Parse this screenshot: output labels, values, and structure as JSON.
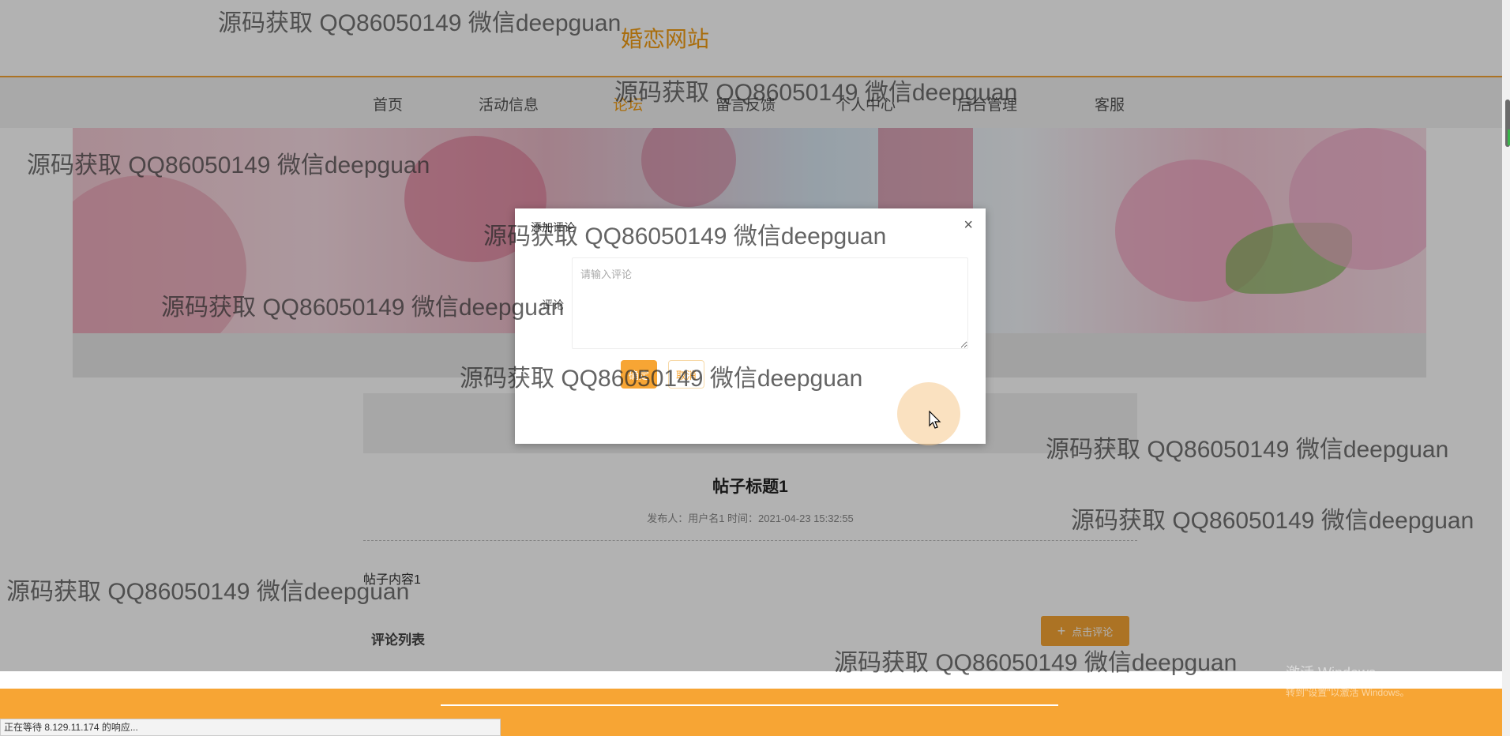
{
  "site": {
    "title": "婚恋网站"
  },
  "nav": {
    "items": [
      {
        "label": "首页",
        "active": false
      },
      {
        "label": "活动信息",
        "active": false
      },
      {
        "label": "论坛",
        "active": true
      },
      {
        "label": "留言反馈",
        "active": false
      },
      {
        "label": "个人中心",
        "active": false
      },
      {
        "label": "后台管理",
        "active": false
      },
      {
        "label": "客服",
        "active": false
      }
    ]
  },
  "post": {
    "title": "帖子标题1",
    "meta": "发布人：用户名1 时间：2021-04-23 15:32:55",
    "content": "帖子内容1"
  },
  "comments": {
    "heading": "评论列表",
    "add_button_label": "点击评论"
  },
  "modal": {
    "title": "添加评论",
    "close_glyph": "×",
    "field_label": "评论",
    "placeholder": "请输入评论",
    "confirm_label": "确定",
    "cancel_label": "取消"
  },
  "status_bar": {
    "text": "正在等待 8.129.11.174 的响应..."
  },
  "windows_activation": {
    "line1": "激活 Windows",
    "line2": "转到\"设置\"以激活 Windows。"
  },
  "watermark": {
    "text": "源码获取 QQ86050149 微信deepguan"
  },
  "colors": {
    "accent": "#f7a534",
    "nav_bg": "#f2f2f2",
    "footer": "#f7a534"
  }
}
